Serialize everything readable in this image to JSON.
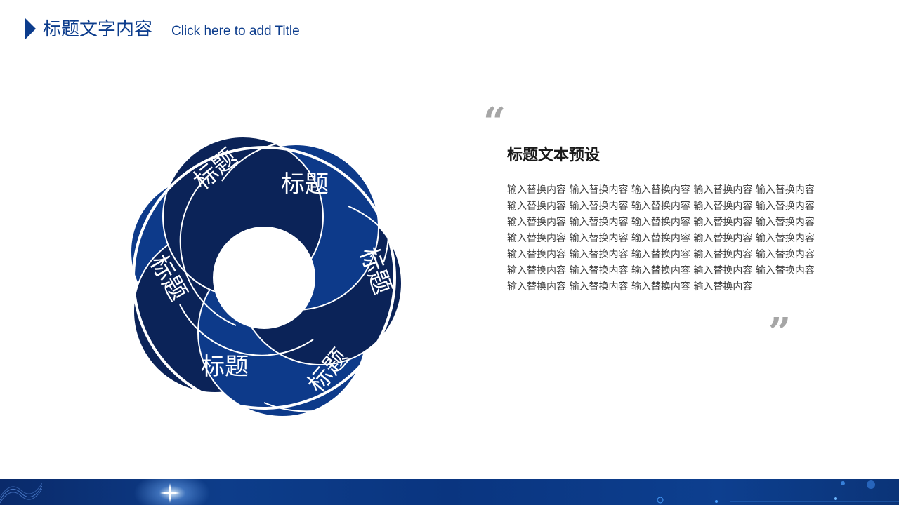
{
  "header": {
    "title": "标题文字内容",
    "subtitle": "Click here to add Title"
  },
  "diagram": {
    "segments": [
      {
        "label": "标题"
      },
      {
        "label": "标题"
      },
      {
        "label": "标题"
      },
      {
        "label": "标题"
      },
      {
        "label": "标题"
      },
      {
        "label": "标题"
      }
    ]
  },
  "text_block": {
    "open_quote": "“",
    "title": "标题文本预设",
    "body": "输入替换内容 输入替换内容 输入替换内容 输入替换内容 输入替换内容 输入替换内容 输入替换内容 输入替换内容 输入替换内容 输入替换内容 输入替换内容 输入替换内容 输入替换内容 输入替换内容 输入替换内容 输入替换内容 输入替换内容 输入替换内容 输入替换内容 输入替换内容 输入替换内容 输入替换内容 输入替换内容 输入替换内容 输入替换内容 输入替换内容 输入替换内容 输入替换内容 输入替换内容 输入替换内容 输入替换内容 输入替换内容 输入替换内容 输入替换内容",
    "close_quote": "”"
  },
  "colors": {
    "brand": "#0c3c8c",
    "segment_dark": "#0b2358",
    "segment_mid": "#0d3a8a",
    "quote_gray": "#a6a6a6"
  }
}
